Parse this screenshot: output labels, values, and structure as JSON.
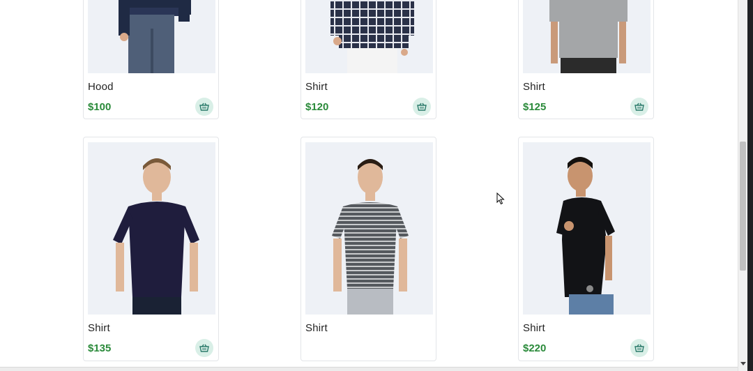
{
  "products": [
    {
      "name": "Hood",
      "price": "$100",
      "figure": "jacket-jeans"
    },
    {
      "name": "Shirt",
      "price": "$120",
      "figure": "plaid-shirt"
    },
    {
      "name": "Shirt",
      "price": "$125",
      "figure": "grey-tee"
    },
    {
      "name": "Shirt",
      "price": "$135",
      "figure": "navy-tee"
    },
    {
      "name": "Shirt",
      "price": "",
      "figure": "striped-tee"
    },
    {
      "name": "Shirt",
      "price": "$220",
      "figure": "black-shirt"
    }
  ],
  "icons": {
    "cart": "basket-icon"
  },
  "colors": {
    "price": "#2a8a3a",
    "cart_bg": "#d9efe7",
    "cart_icon": "#2a7a6a"
  }
}
